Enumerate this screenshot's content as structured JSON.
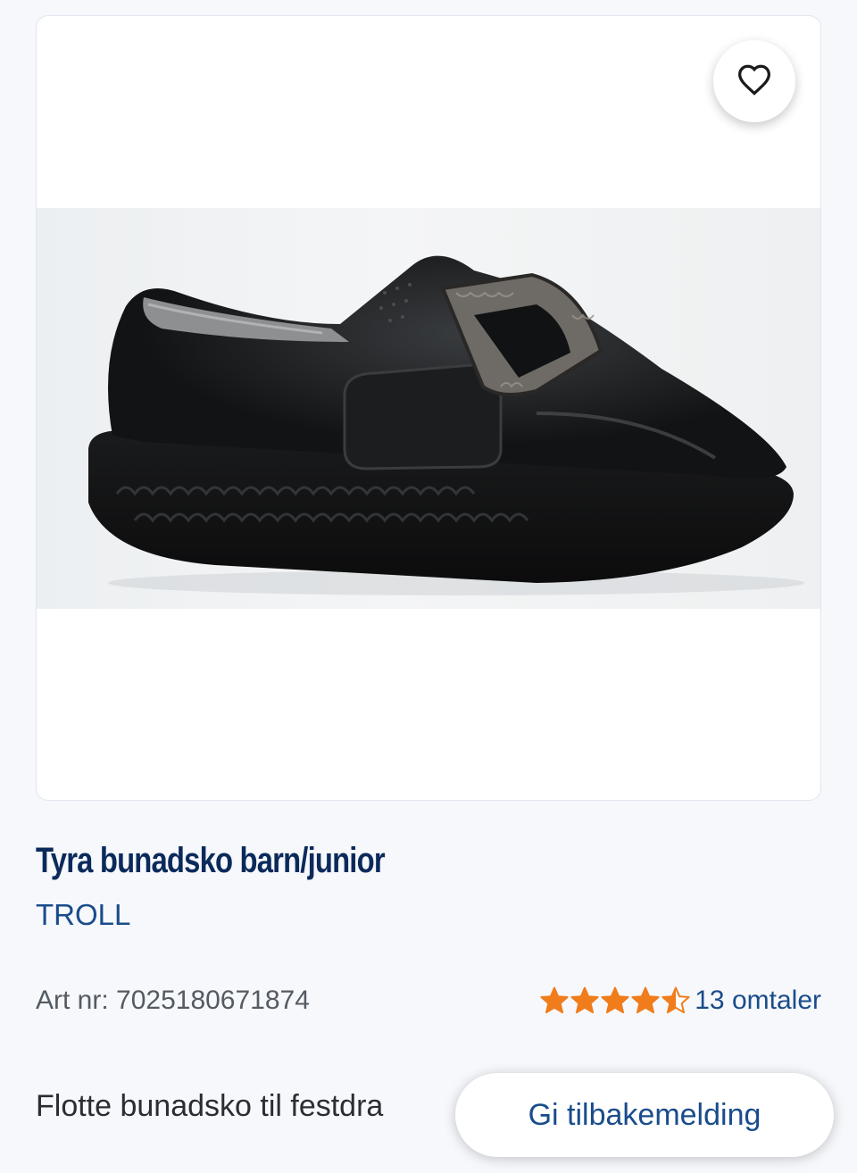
{
  "product": {
    "title": "Tyra bunadsko barn/junior",
    "brand": "TROLL",
    "art_nr": "Art nr: 7025180671874",
    "rating": 4.5,
    "rating_max": 5,
    "reviews": "13 omtaler",
    "description": "Flotte bunadsko til festdra"
  },
  "buttons": {
    "feedback": "Gi tilbakemelding"
  },
  "icons": {
    "favorite": "heart-outline-icon",
    "star": "star-icon"
  },
  "colors": {
    "title": "#0b2a5b",
    "link": "#1a4c8b",
    "star": "#f07c1b",
    "background": "#f6f8fb"
  }
}
